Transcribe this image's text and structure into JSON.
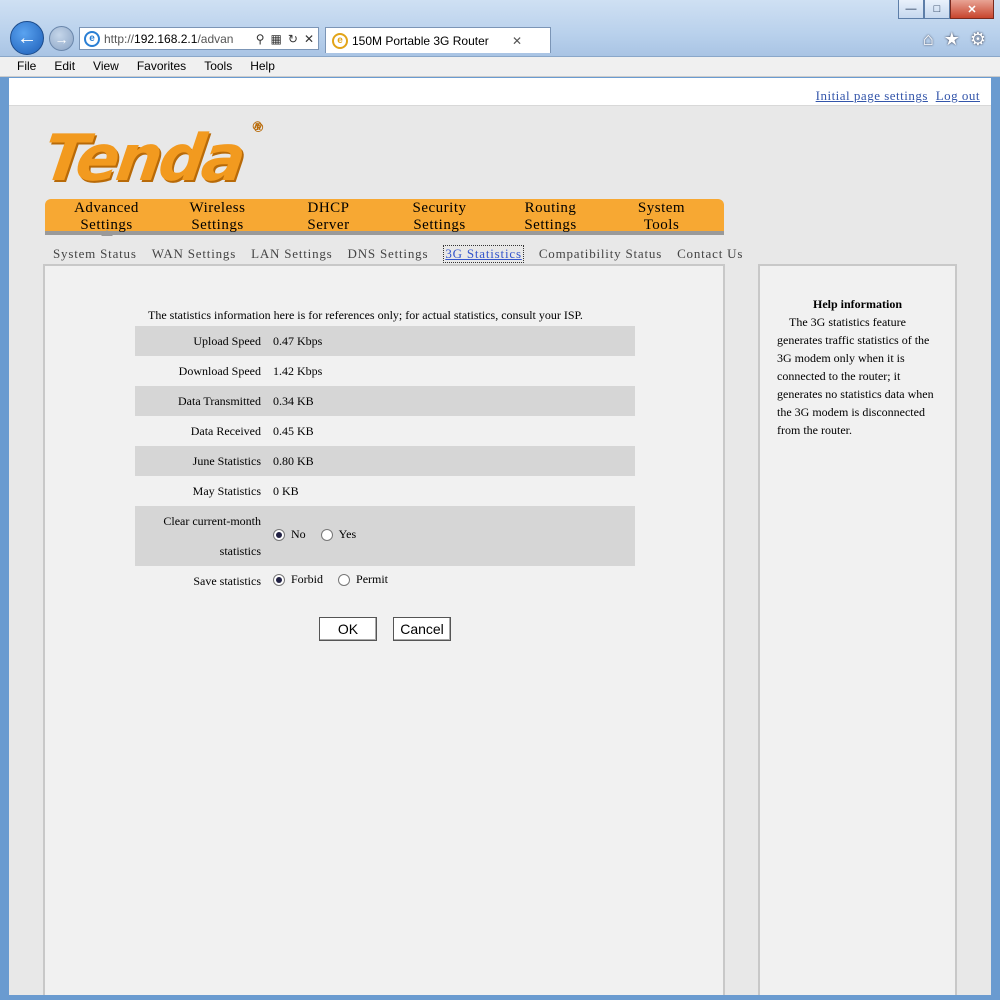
{
  "browser": {
    "address_prefix": "http://",
    "address_host": "192.168.2.1",
    "address_path": "/advan",
    "tab_title": "150M Portable 3G Router",
    "window_controls": [
      "—",
      "□",
      "✕"
    ]
  },
  "menubar": [
    "File",
    "Edit",
    "View",
    "Favorites",
    "Tools",
    "Help"
  ],
  "top_links": {
    "initial": "Initial page settings",
    "logout": "Log out"
  },
  "logo": {
    "text": "Tenda",
    "mark": "®"
  },
  "main_nav": [
    {
      "line1": "Advanced",
      "line2": "Settings"
    },
    {
      "line1": "Wireless",
      "line2": "Settings"
    },
    {
      "line1": "DHCP",
      "line2": "Server"
    },
    {
      "line1": "Security",
      "line2": "Settings"
    },
    {
      "line1": "Routing",
      "line2": "Settings"
    },
    {
      "line1": "System",
      "line2": "Tools"
    }
  ],
  "sub_nav": [
    "System Status",
    "WAN Settings",
    "LAN Settings",
    "DNS Settings",
    "3G Statistics",
    "Compatibility Status",
    "Contact Us"
  ],
  "content": {
    "intro": "The statistics information here is for references only; for actual statistics, consult your ISP.",
    "rows": [
      {
        "label": "Upload Speed",
        "value": "0.47 Kbps"
      },
      {
        "label": "Download Speed",
        "value": "1.42 Kbps"
      },
      {
        "label": "Data Transmitted",
        "value": "0.34 KB"
      },
      {
        "label": "Data Received",
        "value": "0.45 KB"
      },
      {
        "label": "June Statistics",
        "value": "0.80 KB"
      },
      {
        "label": "May Statistics",
        "value": "0 KB"
      }
    ],
    "clear_label": "Clear current-month statistics",
    "clear_options": [
      "No",
      "Yes"
    ],
    "save_label": "Save statistics",
    "save_options": [
      "Forbid",
      "Permit"
    ],
    "ok": "OK",
    "cancel": "Cancel"
  },
  "help": {
    "title": "Help information",
    "text": "The 3G statistics feature generates traffic statistics of the 3G modem only when it is connected to the router; it generates no statistics data when the 3G modem is disconnected from the router."
  },
  "colors": {
    "accent": "#f7a833",
    "link": "#3355aa"
  },
  "icons": [
    "back-arrow-icon",
    "forward-arrow-icon",
    "ie-icon",
    "search-icon",
    "compat-icon",
    "refresh-icon",
    "close-icon",
    "home-icon",
    "star-icon",
    "gear-icon"
  ]
}
